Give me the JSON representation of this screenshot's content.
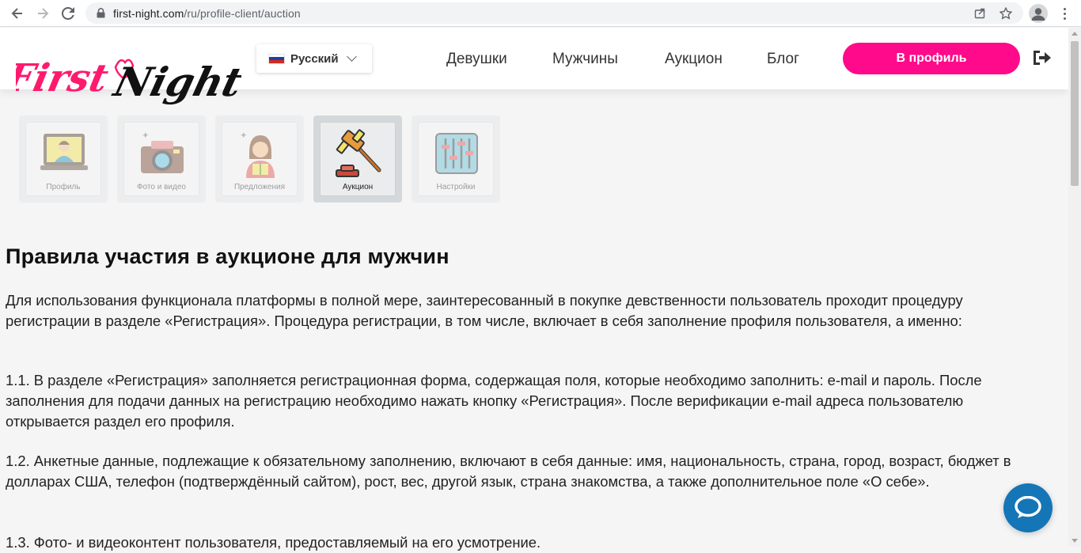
{
  "browser": {
    "url_domain": "first-night.com",
    "url_path": "/ru/profile-client/auction"
  },
  "header": {
    "logo_text_left": "First",
    "logo_text_right": "Night",
    "language": "Русский",
    "nav": [
      {
        "label": "Девушки"
      },
      {
        "label": "Мужчины"
      },
      {
        "label": "Аукцион"
      },
      {
        "label": "Блог"
      }
    ],
    "profile_button": "В профиль"
  },
  "tabs": [
    {
      "label": "Профиль",
      "icon": "profile-icon",
      "active": false
    },
    {
      "label": "Фото и видео",
      "icon": "camera-icon",
      "active": false
    },
    {
      "label": "Предложения",
      "icon": "offers-icon",
      "active": false
    },
    {
      "label": "Аукцион",
      "icon": "gavel-icon",
      "active": true
    },
    {
      "label": "Настройки",
      "icon": "sliders-icon",
      "active": false
    }
  ],
  "content": {
    "title": "Правила участия в аукционе для мужчин",
    "paragraphs": [
      "Для использования функционала платформы в полной мере, заинтересованный в покупке девственности пользователь проходит процедуру регистрации в разделе «Регистрация». Процедура регистрации, в том числе, включает в себя заполнение профиля пользователя, а именно:",
      "1.1. В разделе «Регистрация» заполняется регистрационная форма, содержащая поля, которые необходимо заполнить: e-mail и пароль. После заполнения для подачи данных на регистрацию необходимо нажать кнопку «Регистрация». После верификации e-mail адреса пользователю открывается раздел его профиля.",
      "1.2. Анкетные данные, подлежащие к обязательному заполнению, включают в себя данные: имя, национальность, страна, город, возраст, бюджет в долларах США, телефон (подтверждённый сайтом), рост, вес, другой язык, страна знакомства, а также дополнительное поле «О себе».",
      "1.3. Фото- и видеоконтент пользователя, предоставляемый на его усмотрение."
    ]
  },
  "colors": {
    "brand_pink": "#ff0a8a",
    "chat_blue": "#1475b7"
  }
}
